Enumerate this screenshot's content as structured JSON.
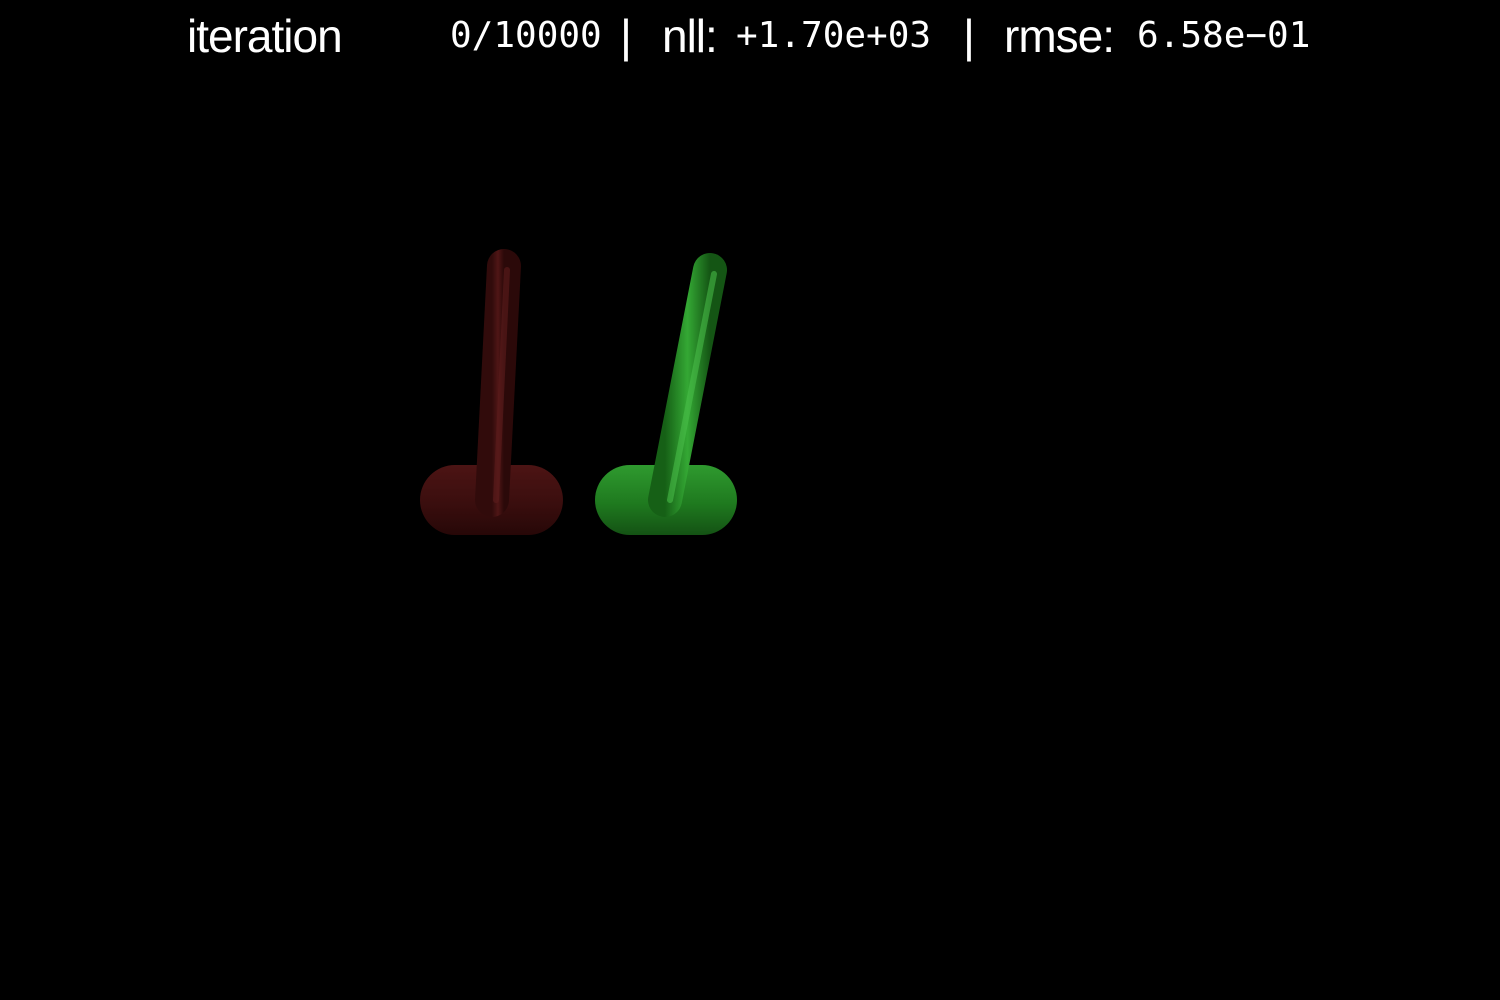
{
  "hud": {
    "iteration_label": "iteration",
    "iteration_value": "0/10000",
    "separator": "|",
    "nll_label": "nll:",
    "nll_value": "+1.70e+03",
    "rmse_label": "rmse:",
    "rmse_value": "6.58e−01"
  },
  "scene": {
    "background_color": "#000000",
    "track_color": "#6b5530",
    "target_cartpole": {
      "color": "#4a1212",
      "opacity": 0.85
    },
    "predicted_cartpole": {
      "color": "#1f7a1f",
      "opacity": 1.0
    }
  }
}
